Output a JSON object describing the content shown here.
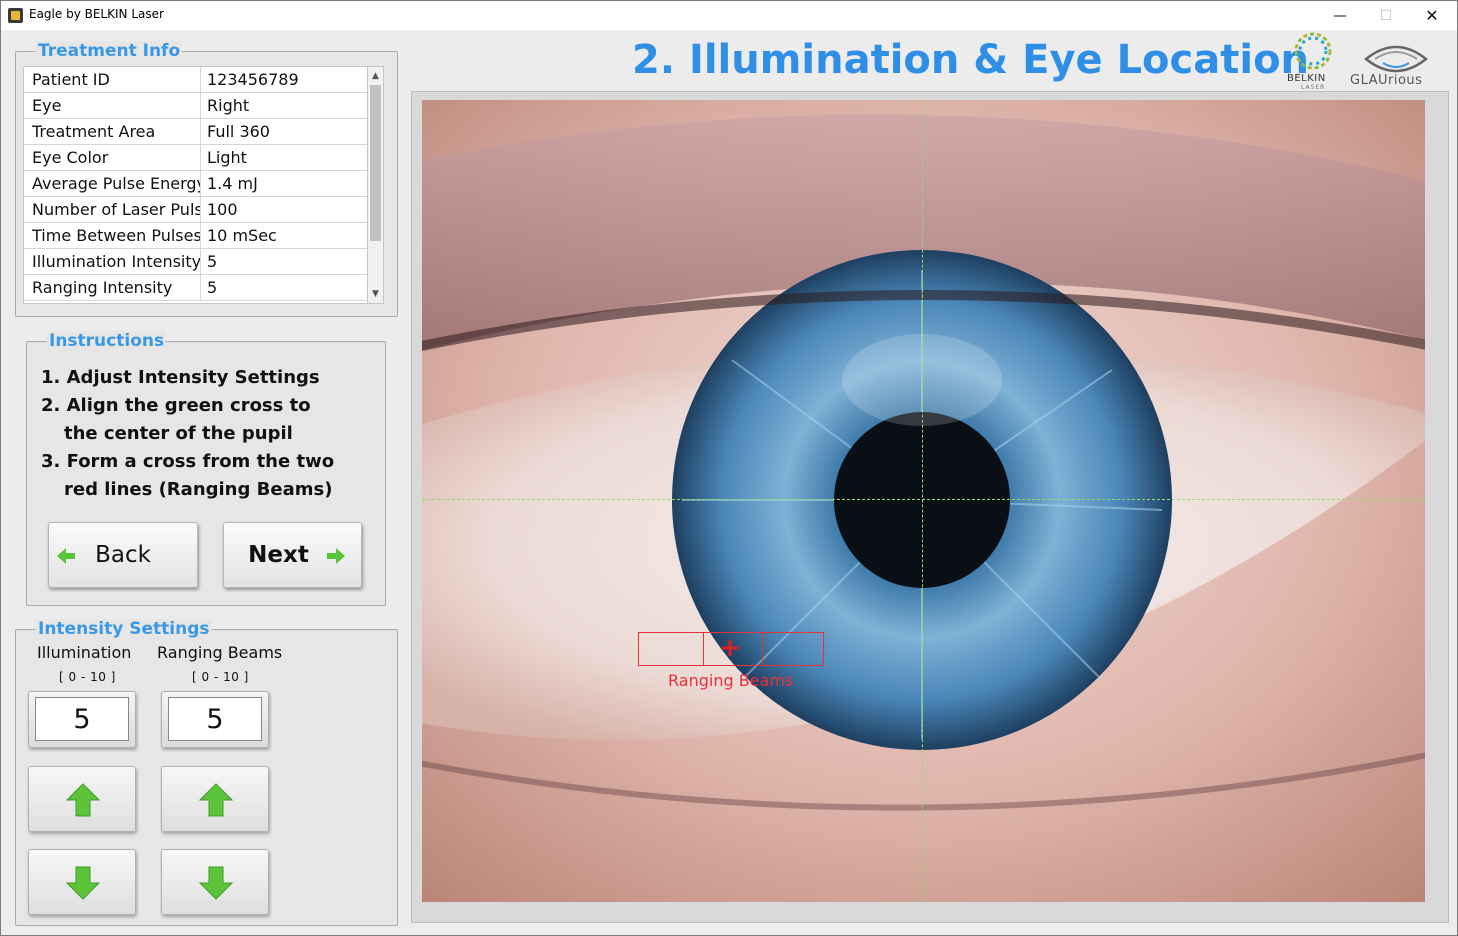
{
  "window": {
    "title": "Eagle by BELKIN Laser",
    "min": "—",
    "max": "☐",
    "close": "✕"
  },
  "heading": "2. Illumination & Eye Location",
  "logos": {
    "belkin": "BELKIN",
    "belkin_sub": "LASER",
    "glaurious": "GLAUrious"
  },
  "treatment": {
    "title": "Treatment Info",
    "rows": [
      {
        "k": "Patient ID",
        "v": "123456789"
      },
      {
        "k": "Eye",
        "v": "Right"
      },
      {
        "k": "Treatment Area",
        "v": "Full 360"
      },
      {
        "k": "Eye Color",
        "v": "Light"
      },
      {
        "k": "Average Pulse Energy",
        "v": "1.4 mJ"
      },
      {
        "k": "Number of Laser Pulse",
        "v": "100"
      },
      {
        "k": "Time Between Pulses",
        "v": "10 mSec"
      },
      {
        "k": "Illumination Intensity",
        "v": "5"
      },
      {
        "k": "Ranging Intensity",
        "v": "5"
      }
    ]
  },
  "instructions": {
    "title": "Instructions",
    "l1": "1. Adjust Intensity Settings",
    "l2": "2. Align the green cross to",
    "l2b": "the center of the pupil",
    "l3": "3. Form a cross from the two",
    "l3b": "red lines (Ranging Beams)",
    "back": "Back",
    "next": "Next"
  },
  "intensity": {
    "title": "Intensity Settings",
    "illum_label": "Illumination",
    "ranging_label": "Ranging Beams",
    "illum_range": "[ 0 - 10 ]",
    "ranging_range": "[ 0 - 10 ]",
    "illum_value": "5",
    "ranging_value": "5"
  },
  "overlay": {
    "ranging_label": "Ranging Beams",
    "plus": "+"
  },
  "colors": {
    "accent": "#2f8fe6",
    "crosshair": "#8fdc6a",
    "ranging": "#e8323a",
    "arrow": "#5cc43a"
  }
}
